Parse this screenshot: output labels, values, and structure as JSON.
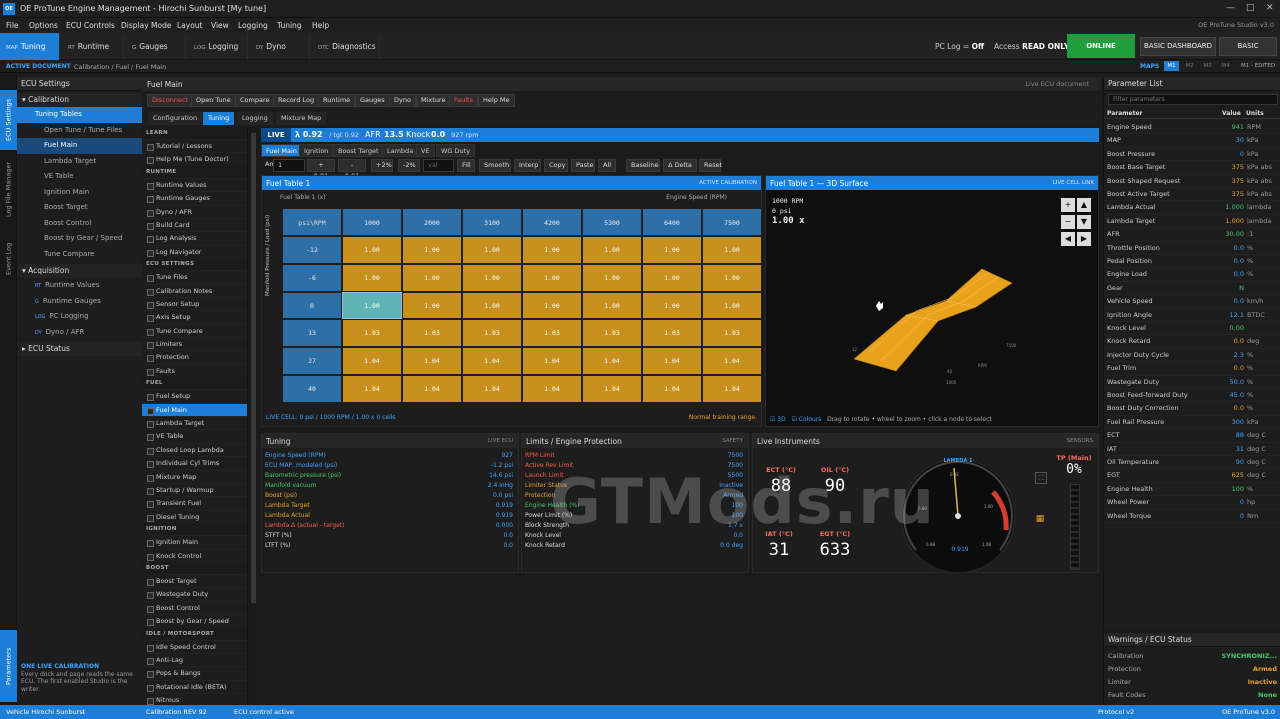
{
  "window": {
    "title": "OE ProTune Engine Management - Hirochi Sunburst [My tune]",
    "logo": "OE",
    "controls": [
      "—",
      "□",
      "✕"
    ]
  },
  "menu": {
    "items": [
      "File",
      "Options",
      "ECU Controls",
      "Display Mode",
      "Layout",
      "View",
      "Logging",
      "Tuning",
      "Help"
    ],
    "version": "OE ProTune Studio v3.0"
  },
  "toolbar": {
    "tabs": [
      {
        "code": "MAP",
        "label": "Tuning"
      },
      {
        "code": "RT",
        "label": "Runtime"
      },
      {
        "code": "G",
        "label": "Gauges"
      },
      {
        "code": "LOG",
        "label": "Logging"
      },
      {
        "code": "DY",
        "label": "Dyno"
      },
      {
        "code": "DTC",
        "label": "Diagnostics"
      }
    ],
    "pclog_label": "PC Log =",
    "pclog_value": "Off",
    "access_label": "Access",
    "access_value": "READ ONLY",
    "online": "ONLINE",
    "basic_dashboard": "BASIC DASHBOARD",
    "basic_settings": "BASIC SETTINGS"
  },
  "crumb": {
    "label": "ACTIVE DOCUMENT",
    "path": "Calibration / Fuel / Fuel Main",
    "maps_label": "MAPS",
    "slots": [
      "M1",
      "M2",
      "M3",
      "M4"
    ],
    "edited": "M1 - EDITED"
  },
  "rail": {
    "ecu_settings": "ECU Settings",
    "log_file_manager": "Log File Manager",
    "event_log": "Event Log",
    "parameters": "Parameters"
  },
  "ecu_panel": {
    "title": "ECU Settings",
    "calibration": "Calibration",
    "tuning_tables": "Tuning Tables",
    "items": [
      "Open Tune / Tune Files",
      "Fuel Main",
      "Lambda Target",
      "VE Table",
      "Ignition Main",
      "Boost Target",
      "Boost Control",
      "Boost by Gear / Speed",
      "Tune Compare"
    ],
    "acquisition": "Acquisition",
    "acq_items": [
      {
        "pfx": "RT",
        "label": "Runtime Values"
      },
      {
        "pfx": "G",
        "label": "Runtime Gauges"
      },
      {
        "pfx": "LOG",
        "label": "PC Logging"
      },
      {
        "pfx": "DY",
        "label": "Dyno / AFR"
      }
    ],
    "ecu_status": "ECU Status",
    "note_title": "ONE LIVE CALIBRATION",
    "note_text": "Every dock and page reads the same ECU. The first enabled Studio is the writer."
  },
  "main": {
    "title": "Fuel Main",
    "live_doc": "Live ECU document",
    "buttons": [
      "Disconnect",
      "Open Tune",
      "Compare",
      "Record Log",
      "Runtime",
      "Gauges",
      "Dyno",
      "Mixture",
      "Faults",
      "Help Me"
    ],
    "tabs": [
      "Configuration",
      "Tuning",
      "Logging",
      "Mixture Map"
    ]
  },
  "nav": {
    "sections": [
      {
        "title": "LEARN",
        "items": [
          "Tutorial / Lessons",
          "Help Me (Tune Doctor)"
        ]
      },
      {
        "title": "RUNTIME",
        "items": [
          "Runtime Values",
          "Runtime Gauges",
          "Dyno / AFR",
          "Build Card",
          "Log Analysis",
          "Log Navigator"
        ]
      },
      {
        "title": "ECU SETTINGS",
        "items": [
          "Tune Files",
          "Calibration Notes",
          "Sensor Setup",
          "Axis Setup",
          "Tune Compare",
          "Limiters",
          "Protection",
          "Faults"
        ]
      },
      {
        "title": "FUEL",
        "items": [
          "Fuel Setup",
          "Fuel Main",
          "Lambda Target",
          "VE Table",
          "Closed Loop Lambda",
          "Individual Cyl Trims",
          "Mixture Map",
          "Startup / Warmup",
          "Transient Fuel",
          "Diesel Tuning"
        ]
      },
      {
        "title": "IGNITION",
        "items": [
          "Ignition Main",
          "Knock Control"
        ]
      },
      {
        "title": "BOOST",
        "items": [
          "Boost Target",
          "Wastegate Duty",
          "Boost Control",
          "Boost by Gear / Speed"
        ]
      },
      {
        "title": "IDLE / MOTORSPORT",
        "items": [
          "Idle Speed Control",
          "Anti-Lag",
          "Pops & Bangs",
          "Rotational Idle (BETA)",
          "Nitrous"
        ]
      }
    ]
  },
  "live": {
    "label": "LIVE",
    "lambda": "λ 0.92",
    "tgt": "/ tgt 0.92",
    "afr_label": "AFR",
    "afr": "13.5",
    "knock_label": "Knock",
    "knock": "0.0",
    "rpm": "927 rpm"
  },
  "table_tabs": [
    "Fuel Main",
    "Ignition",
    "Boost Target",
    "Lambda",
    "VE",
    "WG Duty"
  ],
  "tools": {
    "amt_label": "Amt",
    "amt_value": "1",
    "buttons": [
      "+ 0.01",
      "- 0.01",
      "+2%",
      "-2%"
    ],
    "val_placeholder": "val",
    "more": [
      "Fill",
      "Smooth",
      "Interp",
      "Copy",
      "Paste",
      "All",
      "Baseline",
      "Δ Delta",
      "Reset"
    ]
  },
  "fuel_table": {
    "title": "Fuel Table 1",
    "badge": "ACTIVE CALIBRATION",
    "sub_left": "Fuel Table 1 (x)",
    "sub_right": "Engine Speed (RPM)",
    "corner": "psi\\RPM",
    "y_label": "Manifold Pressure / Load (psi)",
    "cols": [
      "1000",
      "2000",
      "3100",
      "4200",
      "5300",
      "6400",
      "7500"
    ],
    "rows": [
      {
        "h": "-12",
        "v": [
          "1.00",
          "1.00",
          "1.00",
          "1.00",
          "1.00",
          "1.00",
          "1.00"
        ]
      },
      {
        "h": "-6",
        "v": [
          "1.00",
          "1.00",
          "1.00",
          "1.00",
          "1.00",
          "1.00",
          "1.00"
        ]
      },
      {
        "h": "0",
        "v": [
          "1.00",
          "1.00",
          "1.00",
          "1.00",
          "1.00",
          "1.00",
          "1.00"
        ]
      },
      {
        "h": "13",
        "v": [
          "1.03",
          "1.03",
          "1.03",
          "1.03",
          "1.03",
          "1.03",
          "1.03"
        ]
      },
      {
        "h": "27",
        "v": [
          "1.04",
          "1.04",
          "1.04",
          "1.04",
          "1.04",
          "1.04",
          "1.04"
        ]
      },
      {
        "h": "40",
        "v": [
          "1.04",
          "1.04",
          "1.04",
          "1.04",
          "1.04",
          "1.04",
          "1.04"
        ]
      }
    ],
    "selected": {
      "row": 2,
      "col": 0
    },
    "foot_left": "LIVE CELL: 0 psi / 1000 RPM / 1.00 x   0 cells",
    "foot_right": "Normal training range."
  },
  "surface": {
    "title": "Fuel Table 1 — 3D Surface",
    "badge": "LIVE CELL LINK",
    "l1": "1000 RPM",
    "l2": "0 psi",
    "l3": "1.00 x",
    "axis_labels": [
      "12",
      "7500",
      "RPM",
      "40",
      "1000"
    ],
    "foot_3d": "3D",
    "foot_colours": "Colours",
    "foot_text": "Drag to rotate • wheel to zoom • click a node to select",
    "nav": [
      "+",
      "▲",
      "−",
      "▼",
      "◀",
      "▶"
    ]
  },
  "tuning": {
    "title": "Tuning",
    "badge": "LIVE ECU",
    "rows": [
      {
        "k": "Engine Speed (RPM)",
        "v": "927",
        "c": "#3ea3ff"
      },
      {
        "k": "ECU MAP, modeled (psi)",
        "v": "-1.2 psi",
        "c": "#3ea3ff"
      },
      {
        "k": "Barometric pressure (psi)",
        "v": "14.6 psi",
        "c": "#42c96a"
      },
      {
        "k": "Manifold vacuum",
        "v": "2.4 inHg",
        "c": "#42c96a"
      },
      {
        "k": "Boost (psi)",
        "v": "0.0 psi",
        "c": "#e6a22b"
      },
      {
        "k": "Lambda Target",
        "v": "0.919",
        "c": "#e6a22b"
      },
      {
        "k": "Lambda Actual",
        "v": "0.919",
        "c": "#e6a22b"
      },
      {
        "k": "Lambda Δ (actual - target)",
        "v": "0.000",
        "c": "#ff5a4a"
      },
      {
        "k": "STFT (%)",
        "v": "0.0",
        "c": "#dddddd"
      },
      {
        "k": "LTFT (%)",
        "v": "0.0",
        "c": "#dddddd"
      }
    ]
  },
  "limits": {
    "title": "Limits / Engine Protection",
    "badge": "SAFETY",
    "rows": [
      {
        "k": "RPM Limit",
        "v": "7500",
        "c": "#ff5a4a"
      },
      {
        "k": "Active Rev Limit",
        "v": "7500",
        "c": "#ff5a4a"
      },
      {
        "k": "Launch Limit",
        "v": "5500",
        "c": "#ff5a4a"
      },
      {
        "k": "Limiter Status",
        "v": "Inactive",
        "c": "#e6a22b"
      },
      {
        "k": "Protection",
        "v": "Armed",
        "c": "#e6a22b"
      },
      {
        "k": "Engine Health (%)",
        "v": "100",
        "c": "#42c96a"
      },
      {
        "k": "Power Limit (%)",
        "v": "100",
        "c": "#dddddd"
      },
      {
        "k": "Block Strength",
        "v": "1.7 x",
        "c": "#dddddd"
      },
      {
        "k": "Knock Level",
        "v": "0.0",
        "c": "#dddddd"
      },
      {
        "k": "Knock Retard",
        "v": "0.0 deg",
        "c": "#dddddd"
      }
    ]
  },
  "instruments": {
    "title": "Live Instruments",
    "badge": "SENSORS",
    "ect_label": "ECT (°C)",
    "ect": "88",
    "oil_label": "OIL (°C)",
    "oil": "90",
    "iat_label": "IAT (°C)",
    "iat": "31",
    "egt_label": "EGT (°C)",
    "egt": "633",
    "gauge_label": "LAMBDA 1",
    "gauge_value": "0.919",
    "gauge_ticks": [
      "0.68",
      "0.80",
      "0.92",
      "1.00",
      "1.08"
    ],
    "tp_label": "TP (Main)",
    "tp": "0%"
  },
  "params": {
    "title": "Parameter List",
    "filter_placeholder": "Filter parameters",
    "col_param": "Parameter",
    "col_value": "Value",
    "col_units": "Units",
    "rows": [
      {
        "n": "Engine Speed",
        "v": "941",
        "u": "RPM",
        "c": "#42c96a"
      },
      {
        "n": "MAP",
        "v": "30",
        "u": "kPa",
        "c": "#3ea3ff"
      },
      {
        "n": "Boost Pressure",
        "v": "0",
        "u": "kPa",
        "c": "#3ea3ff"
      },
      {
        "n": "Boost Base Target",
        "v": "375",
        "u": "kPa abs",
        "c": "#e6a22b"
      },
      {
        "n": "Boost Shaped Request",
        "v": "375",
        "u": "kPa abs",
        "c": "#e6a22b"
      },
      {
        "n": "Boost Active Target",
        "v": "375",
        "u": "kPa abs",
        "c": "#e6a22b"
      },
      {
        "n": "Lambda Actual",
        "v": "1.000",
        "u": "lambda",
        "c": "#42c96a"
      },
      {
        "n": "Lambda Target",
        "v": "1.000",
        "u": "lambda",
        "c": "#e6a22b"
      },
      {
        "n": "AFR",
        "v": "30.00",
        "u": ":1",
        "c": "#42c96a"
      },
      {
        "n": "Throttle Position",
        "v": "0.0",
        "u": "%",
        "c": "#3ea3ff"
      },
      {
        "n": "Pedal Position",
        "v": "0.0",
        "u": "%",
        "c": "#3ea3ff"
      },
      {
        "n": "Engine Load",
        "v": "0.0",
        "u": "%",
        "c": "#3ea3ff"
      },
      {
        "n": "Gear",
        "v": "N",
        "u": "",
        "c": "#42c96a"
      },
      {
        "n": "Vehicle Speed",
        "v": "0.0",
        "u": "km/h",
        "c": "#3ea3ff"
      },
      {
        "n": "Ignition Angle",
        "v": "12.1",
        "u": "BTDC",
        "c": "#3ea3ff"
      },
      {
        "n": "Knock Level",
        "v": "0.00",
        "u": "",
        "c": "#42c96a"
      },
      {
        "n": "Knock Retard",
        "v": "0.0",
        "u": "deg",
        "c": "#e6a22b"
      },
      {
        "n": "Injector Duty Cycle",
        "v": "2.3",
        "u": "%",
        "c": "#3ea3ff"
      },
      {
        "n": "Fuel Trim",
        "v": "0.0",
        "u": "%",
        "c": "#e6a22b"
      },
      {
        "n": "Wastegate Duty",
        "v": "50.0",
        "u": "%",
        "c": "#3ea3ff"
      },
      {
        "n": "Boost Feed-forward Duty",
        "v": "45.0",
        "u": "%",
        "c": "#3ea3ff"
      },
      {
        "n": "Boost Duty Correction",
        "v": "0.0",
        "u": "%",
        "c": "#e6a22b"
      },
      {
        "n": "Fuel Rail Pressure",
        "v": "300",
        "u": "kPa",
        "c": "#3ea3ff"
      },
      {
        "n": "ECT",
        "v": "88",
        "u": "deg C",
        "c": "#3ea3ff"
      },
      {
        "n": "IAT",
        "v": "31",
        "u": "deg C",
        "c": "#3ea3ff"
      },
      {
        "n": "Oil Temperature",
        "v": "90",
        "u": "deg C",
        "c": "#3ea3ff"
      },
      {
        "n": "EGT",
        "v": "625",
        "u": "deg C",
        "c": "#e6a22b"
      },
      {
        "n": "Engine Health",
        "v": "100",
        "u": "%",
        "c": "#42c96a"
      },
      {
        "n": "Wheel Power",
        "v": "0",
        "u": "hp",
        "c": "#3ea3ff"
      },
      {
        "n": "Wheel Torque",
        "v": "0",
        "u": "Nm",
        "c": "#3ea3ff"
      }
    ]
  },
  "warnings": {
    "title": "Warnings / ECU Status",
    "rows": [
      {
        "n": "Calibration",
        "v": "SYNCHRONIZ...",
        "c": "#42c96a"
      },
      {
        "n": "Protection",
        "v": "Armed",
        "c": "#e6a22b"
      },
      {
        "n": "Limiter",
        "v": "Inactive",
        "c": "#e6a22b"
      },
      {
        "n": "Fault Codes",
        "v": "None",
        "c": "#42c96a"
      }
    ]
  },
  "status": {
    "vehicle": "Vehicle Hirochi Sunburst",
    "calibration": "Calibration REV 92",
    "ecu": "ECU control active",
    "protocol": "Protocol v2",
    "version": "OE ProTune v3.0"
  },
  "watermark": "GTMods.ru"
}
